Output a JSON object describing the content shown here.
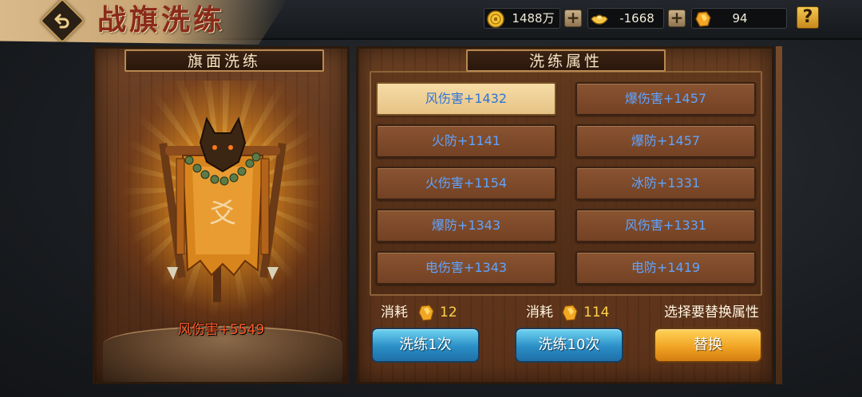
{
  "header": {
    "title": "战旗洗练",
    "currencies": [
      {
        "icon": "gold-coin-icon",
        "value": "1488万"
      },
      {
        "icon": "silver-ingot-icon",
        "value": "-1668"
      },
      {
        "icon": "refine-stone-icon",
        "value": "94"
      }
    ],
    "help_label": "?"
  },
  "left_panel": {
    "title": "旗面洗练",
    "flag_stat": "风伤害+5549"
  },
  "right_panel": {
    "title": "洗练属性",
    "attributes": [
      {
        "label": "风伤害+1432",
        "selected": true
      },
      {
        "label": "爆伤害+1457",
        "selected": false
      },
      {
        "label": "火防+1141",
        "selected": false
      },
      {
        "label": "爆防+1457",
        "selected": false
      },
      {
        "label": "火伤害+1154",
        "selected": false
      },
      {
        "label": "冰防+1331",
        "selected": false
      },
      {
        "label": "爆防+1343",
        "selected": false
      },
      {
        "label": "风伤害+1331",
        "selected": false
      },
      {
        "label": "电伤害+1343",
        "selected": false
      },
      {
        "label": "电防+1419",
        "selected": false
      }
    ],
    "cost_label_1": "消耗",
    "cost_value_1": "12",
    "cost_label_2": "消耗",
    "cost_value_2": "114",
    "hint": "选择要替换属性",
    "buttons": {
      "refine_once": "洗练1次",
      "refine_ten": "洗练10次",
      "replace": "替换"
    }
  },
  "colors": {
    "attribute_text": "#5fa3ff",
    "flag_stat": "#ff5a26",
    "cost_value": "#ffd34a",
    "title": "#8b2a1a"
  }
}
